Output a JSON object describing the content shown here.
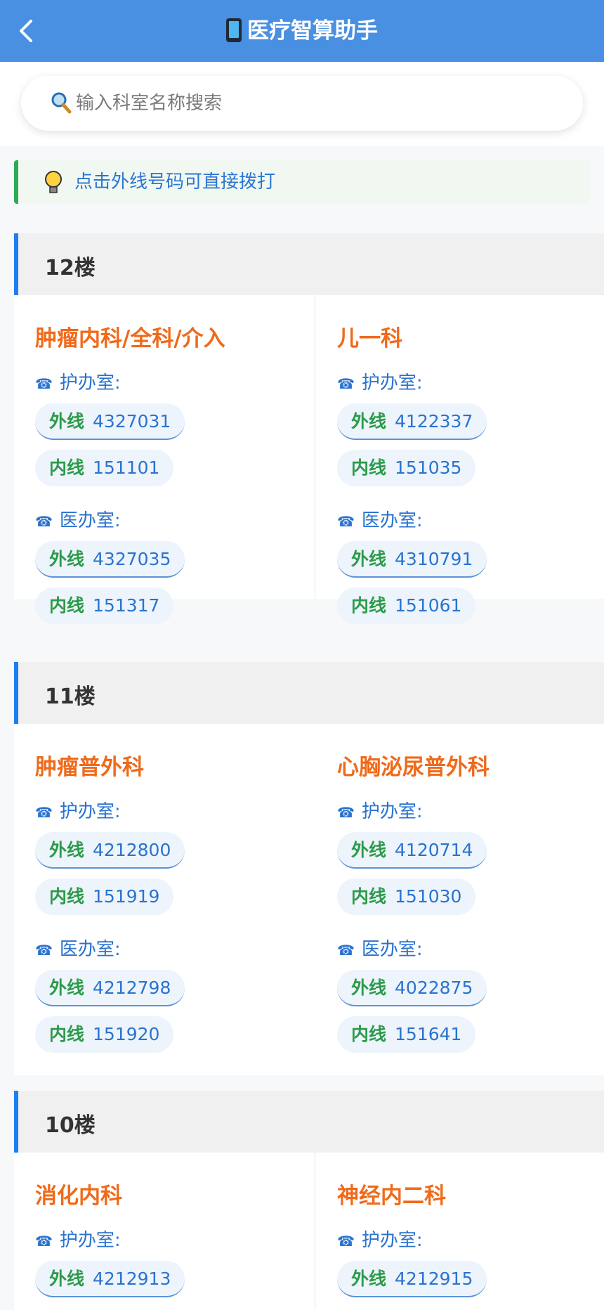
{
  "header": {
    "title": "医疗智算助手"
  },
  "search": {
    "placeholder": "输入科室名称搜索"
  },
  "tip": {
    "text": "点击外线号码可直接拨打"
  },
  "labels": {
    "ext": "外线",
    "int": "内线",
    "nurse": "护办室:",
    "doctor": "医办室:"
  },
  "sections": [
    {
      "floor": "12楼",
      "depts": [
        {
          "name": "肿瘤内科/全科/介入",
          "nurse_ext": "4327031",
          "nurse_int": "151101",
          "doctor_ext": "4327035",
          "doctor_int": "151317"
        },
        {
          "name": "儿一科",
          "nurse_ext": "4122337",
          "nurse_int": "151035",
          "doctor_ext": "4310791",
          "doctor_int": "151061"
        }
      ]
    },
    {
      "floor": "11楼",
      "depts": [
        {
          "name": "肿瘤普外科",
          "nurse_ext": "4212800",
          "nurse_int": "151919",
          "doctor_ext": "4212798",
          "doctor_int": "151920"
        },
        {
          "name": "心胸泌尿普外科",
          "nurse_ext": "4120714",
          "nurse_int": "151030",
          "doctor_ext": "4022875",
          "doctor_int": "151641"
        }
      ]
    },
    {
      "floor": "10楼",
      "depts": [
        {
          "name": "消化内科",
          "nurse_ext": "4212913"
        },
        {
          "name": "神经内二科",
          "nurse_ext": "4212915"
        }
      ]
    }
  ]
}
